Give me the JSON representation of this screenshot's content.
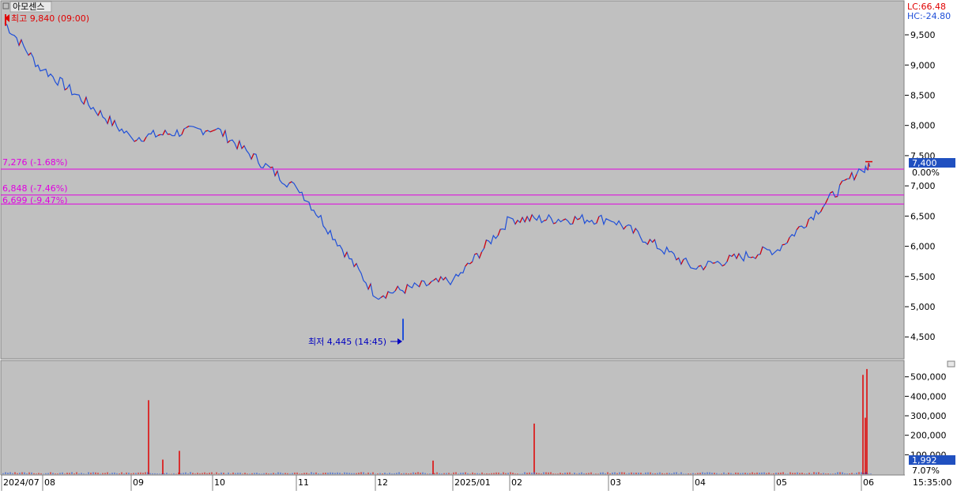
{
  "stock_name": "아모센스",
  "indicators": {
    "lc": "LC:66.48",
    "hc": "HC:-24.80"
  },
  "annotations": {
    "high_label": "최고 9,840 (09:00)",
    "low_label": "최저 4,445 (14:45)"
  },
  "current": {
    "price_label": "7,400",
    "pct_label": "0.00%",
    "volume_label": "1,992",
    "volume_pct_label": "7.07%"
  },
  "time_label": "15:35:00",
  "colors": {
    "up": "#e00000",
    "down": "#1f4fd8",
    "hline": "#e000e0",
    "background": "#c0c0c0",
    "badge": "#2050c0"
  },
  "chart_data": [
    {
      "type": "line",
      "panel": "price",
      "title": "아모센스",
      "categories": [
        "2024/07",
        "08",
        "09",
        "10",
        "11",
        "12",
        "2025/01",
        "02",
        "03",
        "04",
        "05",
        "06"
      ],
      "x": [
        "2024/07",
        "08",
        "09",
        "10",
        "11",
        "12",
        "2025/01",
        "02",
        "03",
        "04",
        "05",
        "06"
      ],
      "series": [
        {
          "name": "",
          "values": [
            9700,
            8900,
            7800,
            7950,
            6950,
            5200,
            5450,
            6450,
            6450,
            5650,
            5950,
            7300
          ]
        }
      ],
      "high": {
        "value": 9840,
        "time": "09:00"
      },
      "low": {
        "value": 4445,
        "time": "14:45"
      },
      "horizontal_lines": [
        {
          "value": 7276,
          "label": "7,276 (-1.68%)"
        },
        {
          "value": 6848,
          "label": "6,848 (-7.46%)"
        },
        {
          "value": 6699,
          "label": "6,699 (-9.47%)"
        }
      ],
      "yticks": [
        {
          "value": 4500,
          "label": "4,500"
        },
        {
          "value": 5000,
          "label": "5,000"
        },
        {
          "value": 5500,
          "label": "5,500"
        },
        {
          "value": 6000,
          "label": "6,000"
        },
        {
          "value": 6500,
          "label": "6,500"
        },
        {
          "value": 7000,
          "label": "7,000"
        },
        {
          "value": 7500,
          "label": "7,500"
        },
        {
          "value": 8000,
          "label": "8,000"
        },
        {
          "value": 8500,
          "label": "8,500"
        },
        {
          "value": 9000,
          "label": "9,000"
        },
        {
          "value": 9500,
          "label": "9,500"
        }
      ],
      "ylim": [
        4150,
        10050
      ],
      "current_value": 7400,
      "grid": false
    },
    {
      "type": "bar",
      "panel": "volume",
      "categories": [
        "2024/07",
        "08",
        "09",
        "10",
        "11",
        "12",
        "2025/01",
        "02",
        "03",
        "04",
        "05",
        "06"
      ],
      "spikes": [
        {
          "month": "09",
          "value": 380000
        },
        {
          "month": "09",
          "value": 75000
        },
        {
          "month": "09",
          "value": 120000
        },
        {
          "month": "12",
          "value": 70000
        },
        {
          "month": "02",
          "value": 260000
        },
        {
          "month": "06",
          "value": 510000
        },
        {
          "month": "06",
          "value": 540000
        },
        {
          "month": "06",
          "value": 290000
        }
      ],
      "yticks": [
        {
          "value": 100000,
          "label": "100,000"
        },
        {
          "value": 200000,
          "label": "200,000"
        },
        {
          "value": 300000,
          "label": "300,000"
        },
        {
          "value": 400000,
          "label": "400,000"
        },
        {
          "value": 500000,
          "label": "500,000"
        }
      ],
      "ylim": [
        0,
        580000
      ],
      "current_value": 1992
    }
  ]
}
